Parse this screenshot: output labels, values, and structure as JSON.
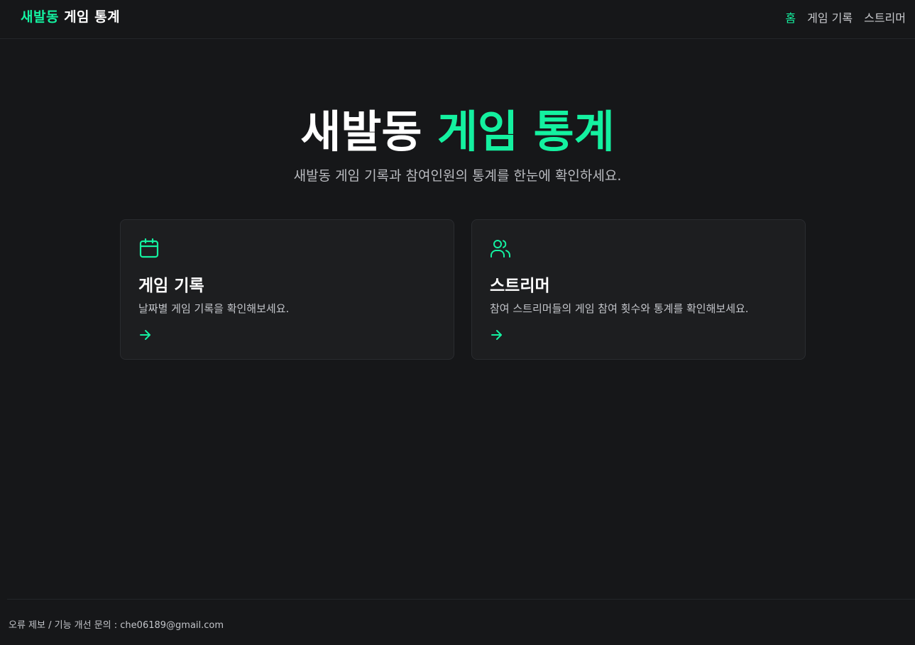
{
  "colors": {
    "accent": "#14f1a0",
    "background": "#161719",
    "card_background": "#1d1e20"
  },
  "navbar": {
    "brand_accent": "새발동",
    "brand_rest": " 게임 통계",
    "links": [
      {
        "label": "홈",
        "active": true
      },
      {
        "label": "게임 기록",
        "active": false
      },
      {
        "label": "스트리머",
        "active": false
      }
    ]
  },
  "hero": {
    "title_plain": "새발동 ",
    "title_accent": "게임 통계",
    "subtitle": "새발동 게임 기록과 참여인원의 통계를 한눈에 확인하세요."
  },
  "cards": [
    {
      "icon": "calendar-icon",
      "title": "게임 기록",
      "description": "날짜별 게임 기록을 확인해보세요."
    },
    {
      "icon": "users-icon",
      "title": "스트리머",
      "description": "참여 스트리머들의 게임 참여 횟수와 통계를 확인해보세요."
    }
  ],
  "footer": {
    "text": "오류 제보 / 기능 개선 문의 : che06189@gmail.com"
  }
}
